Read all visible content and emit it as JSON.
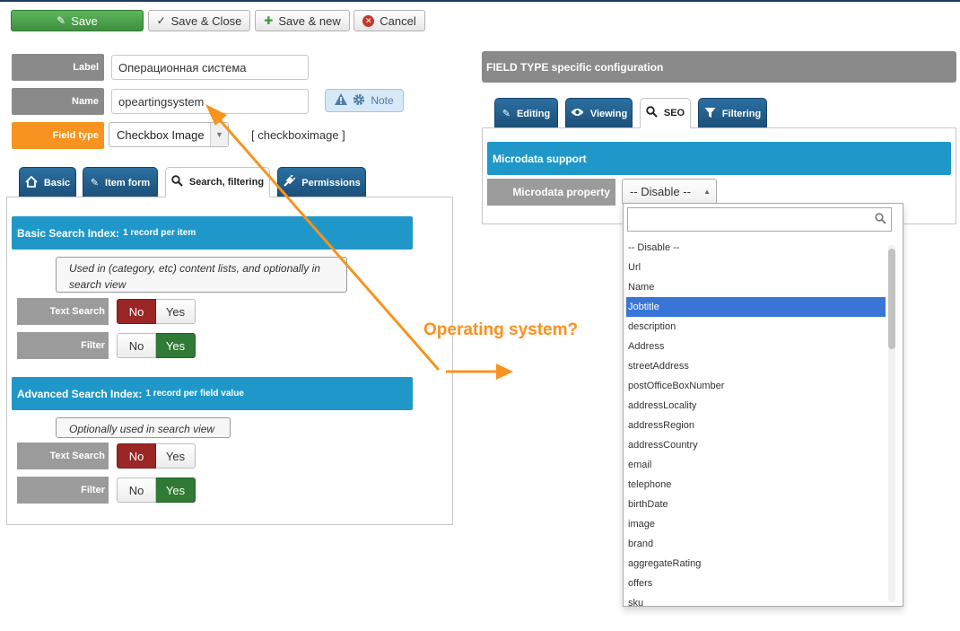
{
  "toolbar": {
    "save": "Save",
    "save_close": "Save & Close",
    "save_new": "Save & new",
    "cancel": "Cancel"
  },
  "form": {
    "label_label": "Label",
    "label_value": "Операционная система",
    "name_label": "Name",
    "name_value": "opeartingsystem",
    "note_label": "Note",
    "fieldtype_label": "Field type",
    "fieldtype_value": "Checkbox Image",
    "fieldtype_name": "[ checkboximage ]"
  },
  "left_tabs": [
    "Basic",
    "Item form",
    "Search, filtering",
    "Permissions"
  ],
  "basic_index": {
    "title": "Basic Search Index:",
    "subtitle": "1 record per item",
    "desc": "Used in (category, etc) content lists, and optionally in search view",
    "text_search_label": "Text Search",
    "filter_label": "Filter",
    "no": "No",
    "yes": "Yes"
  },
  "advanced_index": {
    "title": "Advanced Search Index:",
    "subtitle": "1 record per field value",
    "desc": "Optionally used in search view",
    "text_search_label": "Text Search",
    "filter_label": "Filter",
    "no": "No",
    "yes": "Yes"
  },
  "right": {
    "header": "FIELD TYPE specific configuration",
    "tabs": [
      "Editing",
      "Viewing",
      "SEO",
      "Filtering"
    ],
    "microdata_title": "Microdata support",
    "microdata_label": "Microdata property",
    "microdata_value": "-- Disable --"
  },
  "dropdown": {
    "search_value": "",
    "options": [
      "-- Disable --",
      "Url",
      "Name",
      "Jobtitle",
      "description",
      "Address",
      "streetAddress",
      "postOfficeBoxNumber",
      "addressLocality",
      "addressRegion",
      "addressCountry",
      "email",
      "telephone",
      "birthDate",
      "image",
      "brand",
      "aggregateRating",
      "offers",
      "sku"
    ],
    "highlighted": "Jobtitle"
  },
  "annotation": "Operating system?",
  "colors": {
    "save_green": "#4cae4c",
    "tab_blue": "#24608f",
    "bar_blue": "#1f98c9",
    "annotation_orange": "#f7931e",
    "no_red": "#9b2626",
    "yes_green": "#2f7a34",
    "highlight": "#3875d7"
  }
}
